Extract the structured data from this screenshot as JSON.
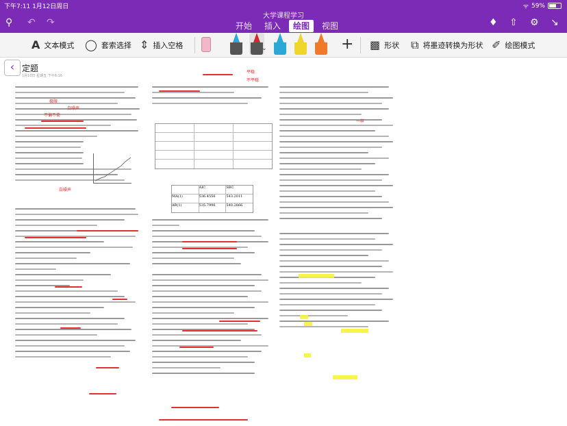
{
  "status": {
    "time_date": "下午7:11   1月12日周日",
    "battery": "59%"
  },
  "app": {
    "title": "大学课程学习"
  },
  "tabs": [
    {
      "label": "开始"
    },
    {
      "label": "插入"
    },
    {
      "label": "绘图",
      "active": true
    },
    {
      "label": "视图"
    }
  ],
  "toolbar": {
    "text_mode": "文本模式",
    "lasso": "套索选择",
    "insert_space": "插入空格",
    "shapes": "形状",
    "ink_to_shape": "将墨迹转换为形状",
    "draw_mode": "绘图模式"
  },
  "pens": [
    {
      "color": "#2ba7d8"
    },
    {
      "color": "#d7262f",
      "selected": true
    },
    {
      "color": "#2ba7d8"
    },
    {
      "color": "#f2d52a"
    },
    {
      "color": "#f0792a"
    }
  ],
  "page": {
    "title": "定题",
    "meta": "1月10日 星期五      下午6:16"
  },
  "table": {
    "cells": [
      "AIC",
      "SBC",
      "MA(1)",
      "536.4556",
      "543.2011",
      "AR(1)",
      "535.7996",
      "540.2866"
    ]
  },
  "handwriting": [
    "极限",
    "白噪声",
    "不偏不倚",
    "白噪声",
    "平稳",
    "不平稳",
    "一样"
  ]
}
